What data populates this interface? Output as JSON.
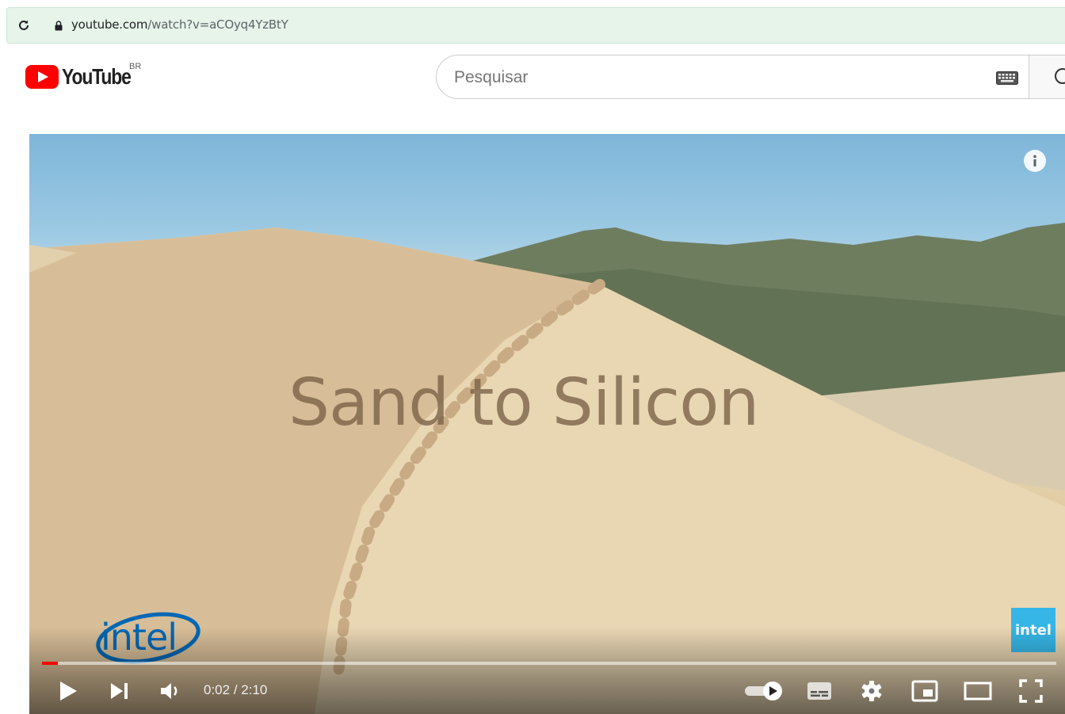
{
  "browser": {
    "url_domain": "youtube.com",
    "url_path": "/watch?v=aCOyq4YzBtY"
  },
  "header": {
    "logo_text": "YouTube",
    "region": "BR",
    "search_placeholder": "Pesquisar"
  },
  "player": {
    "overlay_title": "Sand to Silicon",
    "watermark_text": "intel",
    "logo_text": "intel",
    "time_current": "0:02",
    "time_separator": " / ",
    "time_total": "2:10",
    "progress_fraction": 0.016,
    "autoplay_on": true
  },
  "colors": {
    "brand_red": "#ff0000",
    "intel_blue": "#0068b5",
    "watermark_blue": "#36b6e6"
  }
}
